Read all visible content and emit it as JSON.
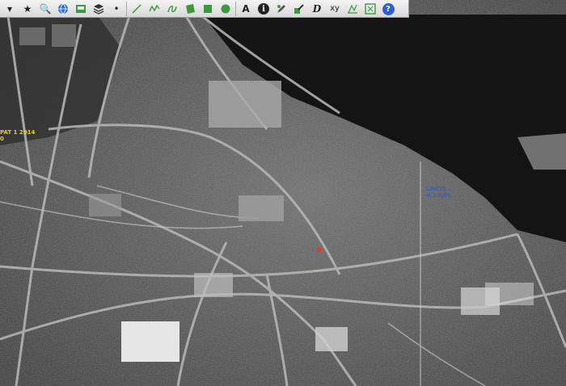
{
  "toolbar": {
    "tools": [
      {
        "name": "select-arrow-icon",
        "glyph": "▾"
      },
      {
        "name": "star-icon",
        "glyph": "★"
      },
      {
        "name": "search-icon",
        "glyph": "🔍"
      },
      {
        "name": "globe-icon",
        "glyph": ""
      },
      {
        "name": "layer-image-icon",
        "glyph": ""
      },
      {
        "name": "layers-icon",
        "glyph": ""
      },
      {
        "name": "point-icon",
        "glyph": "•"
      },
      {
        "name": "line-icon",
        "glyph": ""
      },
      {
        "name": "polyline-icon",
        "glyph": ""
      },
      {
        "name": "freehand-icon",
        "glyph": ""
      },
      {
        "name": "polygon-icon",
        "glyph": ""
      },
      {
        "name": "rectangle-icon",
        "glyph": ""
      },
      {
        "name": "circle-icon",
        "glyph": ""
      },
      {
        "name": "text-icon",
        "glyph": "A"
      },
      {
        "name": "info-icon",
        "glyph": "i"
      },
      {
        "name": "edit-features-icon",
        "glyph": ""
      },
      {
        "name": "edit-layer-icon",
        "glyph": ""
      },
      {
        "name": "d-tool-icon",
        "glyph": "D"
      },
      {
        "name": "xy-coordinates-icon",
        "glyph": "xy"
      },
      {
        "name": "measure-icon",
        "glyph": ""
      },
      {
        "name": "map-frame-icon",
        "glyph": ""
      },
      {
        "name": "help-icon",
        "glyph": "?"
      }
    ]
  },
  "map": {
    "labels": [
      {
        "name": "map-label-west",
        "lines": [
          "PAT 1 2014",
          "0"
        ],
        "color": "#e8d400"
      },
      {
        "name": "map-label-east",
        "lines": [
          "LANTE -",
          "A 1 GOL"
        ],
        "color": "#2f5fe0"
      }
    ],
    "marker_color": "#e03a2a"
  }
}
